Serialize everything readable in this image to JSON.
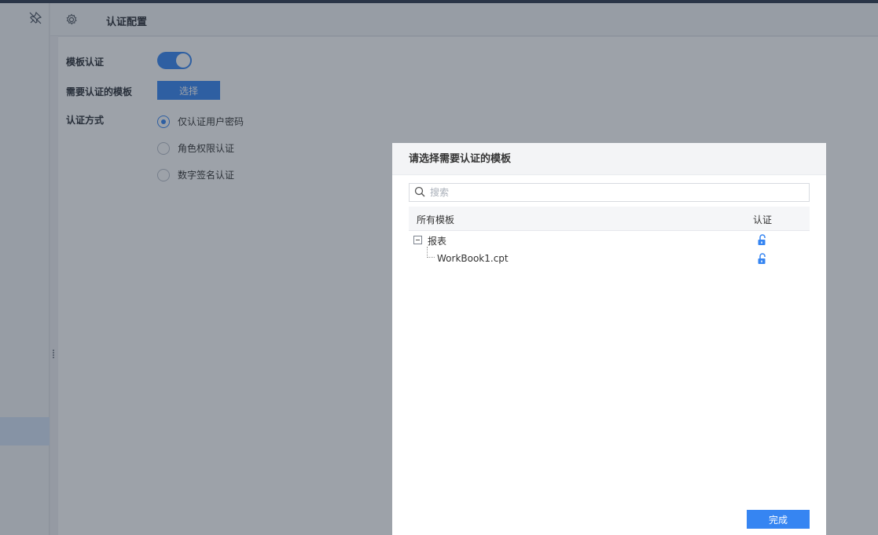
{
  "header": {
    "title": "认证配置",
    "settings_icon": "gear-icon"
  },
  "sidebar": {
    "pin_icon": "pin-off-icon"
  },
  "form": {
    "template_auth_label": "模板认证",
    "template_auth_enabled": true,
    "templates_label": "需要认证的模板",
    "select_button": "选择",
    "auth_method_label": "认证方式",
    "auth_methods": [
      {
        "label": "仅认证用户密码",
        "checked": true
      },
      {
        "label": "角色权限认证",
        "checked": false
      },
      {
        "label": "数字签名认证",
        "checked": false
      }
    ]
  },
  "dialog": {
    "title": "请选择需要认证的模板",
    "search_placeholder": "搜索",
    "columns": {
      "name": "所有模板",
      "auth": "认证"
    },
    "tree": [
      {
        "label": "报表",
        "type": "folder",
        "expanded": true,
        "lock_icon": "unlock-icon"
      },
      {
        "label": "WorkBook1.cpt",
        "type": "file",
        "lock_icon": "unlock-icon"
      }
    ],
    "done_button": "完成"
  },
  "colors": {
    "accent": "#3685f2",
    "mask": "rgba(38,48,64,0.45)",
    "top_strip": "#2f3a4d"
  }
}
